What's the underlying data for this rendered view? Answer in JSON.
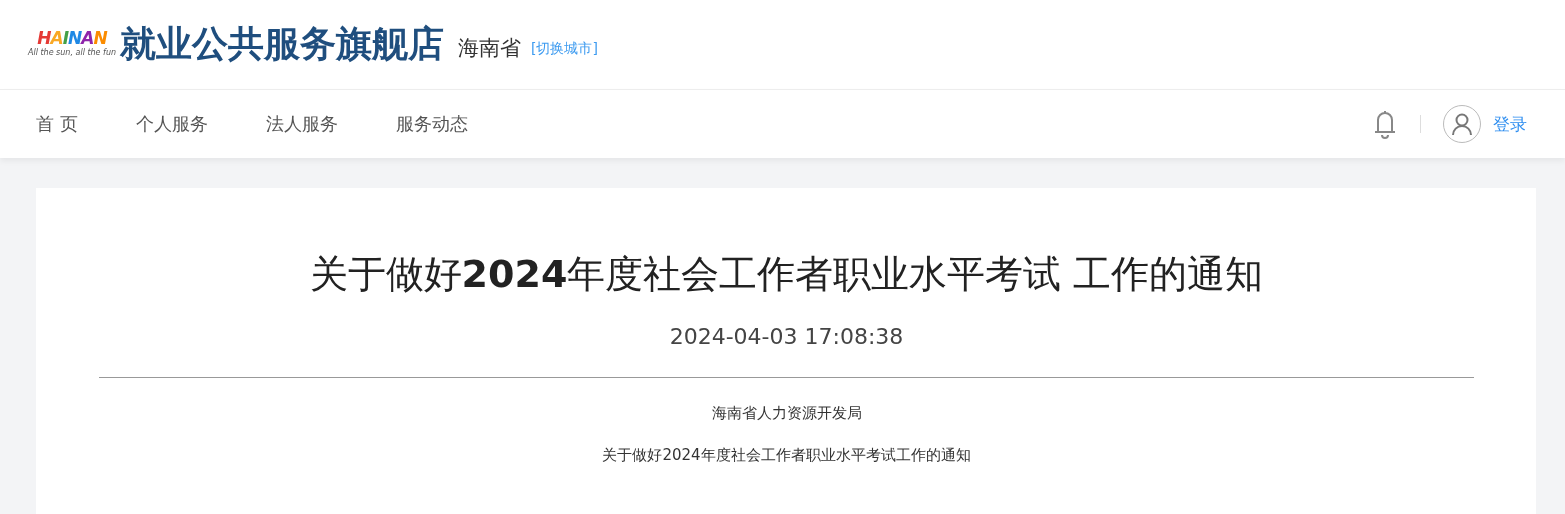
{
  "header": {
    "logo_text": "HAINAN",
    "logo_tagline": "All the sun, all the fun",
    "site_title": "就业公共服务旗舰店",
    "province": "海南省",
    "switch_city": "[切换城市]"
  },
  "nav": {
    "items": [
      {
        "label": "首 页"
      },
      {
        "label": "个人服务"
      },
      {
        "label": "法人服务"
      },
      {
        "label": "服务动态"
      }
    ],
    "login": "登录"
  },
  "article": {
    "title": "关于做好**2024**年度社会工作者职业水平考试 工作的通知",
    "date": "2024-04-03 17:08:38",
    "paragraphs": [
      "海南省人力资源开发局",
      "关于做好2024年度社会工作者职业水平考试工作的通知"
    ]
  }
}
